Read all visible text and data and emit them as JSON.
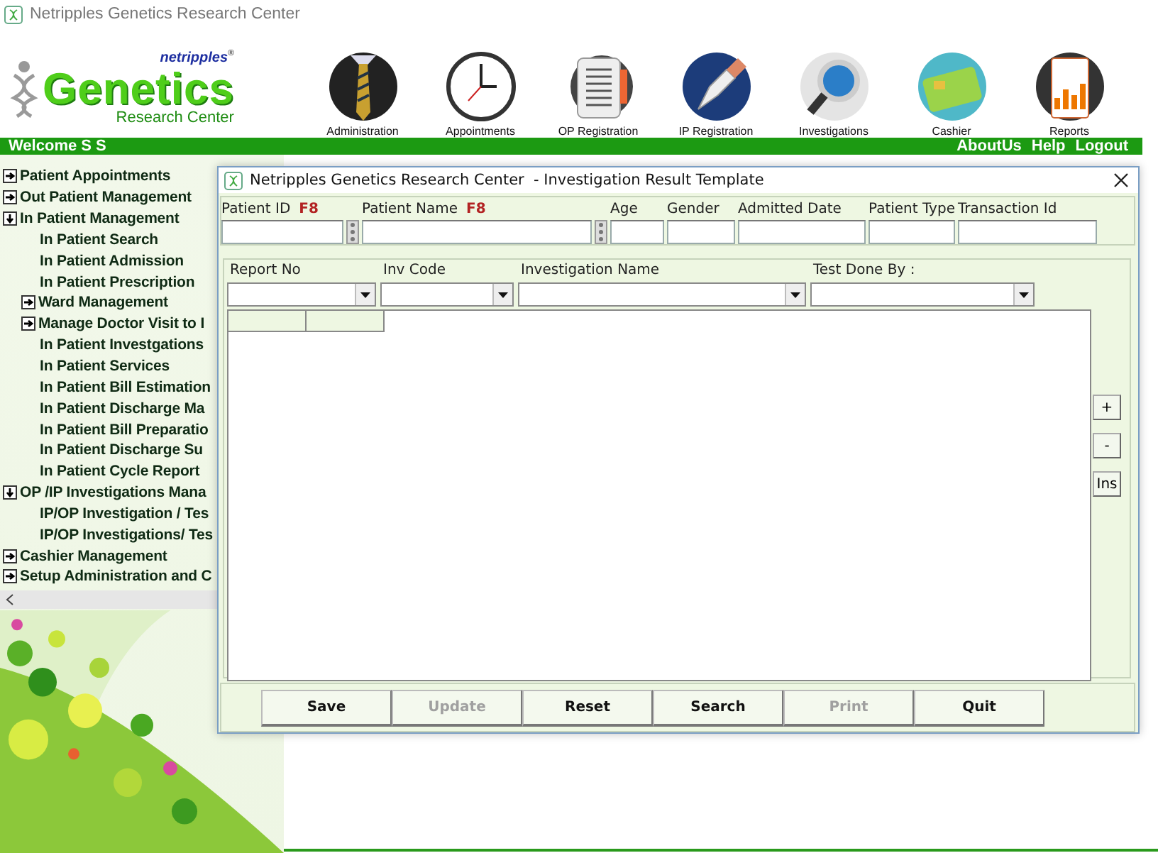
{
  "window": {
    "title": "Netripples Genetics Research Center"
  },
  "logo": {
    "brand": "netripples$^{®}$",
    "name": "Genetics",
    "tagline": "Research Center"
  },
  "modules": [
    {
      "label": "Administration",
      "kind": "suit"
    },
    {
      "label": "Appointments",
      "kind": "clock"
    },
    {
      "label": "OP Registration",
      "kind": "document"
    },
    {
      "label": "IP Registration",
      "kind": "pen"
    },
    {
      "label": "Investigations",
      "kind": "magnifier"
    },
    {
      "label": "Cashier",
      "kind": "card"
    },
    {
      "label": "Reports",
      "kind": "clipboard"
    }
  ],
  "nav_bar": {
    "welcome": "Welcome S S",
    "links": [
      "AboutUs",
      "Help",
      "Logout"
    ]
  },
  "sidebar": {
    "items": [
      {
        "label": "Patient Appointments",
        "kind": "folder",
        "expanded": false
      },
      {
        "label": "Out Patient Management",
        "kind": "folder",
        "expanded": false
      },
      {
        "label": "In Patient Management",
        "kind": "folder",
        "expanded": true,
        "children": [
          {
            "label": "In Patient Search",
            "kind": "leaf"
          },
          {
            "label": "In Patient Admission",
            "kind": "leaf"
          },
          {
            "label": "In Patient Prescription",
            "kind": "leaf"
          },
          {
            "label": "Ward Management",
            "kind": "folder",
            "expanded": false
          },
          {
            "label": "Manage Doctor Visit to I",
            "kind": "folder",
            "expanded": false
          },
          {
            "label": "In Patient Investgations",
            "kind": "leaf"
          },
          {
            "label": "In Patient Services",
            "kind": "leaf"
          },
          {
            "label": "In Patient Bill Estimation",
            "kind": "leaf"
          },
          {
            "label": "In Patient Discharge Ma",
            "kind": "leaf"
          },
          {
            "label": "In Patient Bill Preparatio",
            "kind": "leaf"
          },
          {
            "label": "In Patient Discharge Su",
            "kind": "leaf"
          },
          {
            "label": "In Patient Cycle Report",
            "kind": "leaf"
          }
        ]
      },
      {
        "label": "OP /IP Investigations Mana",
        "kind": "folder",
        "expanded": true,
        "children": [
          {
            "label": "IP/OP Investigation / Tes",
            "kind": "leaf"
          },
          {
            "label": "IP/OP Investigations/ Tes",
            "kind": "leaf"
          }
        ]
      },
      {
        "label": "Cashier Management",
        "kind": "folder",
        "expanded": false
      },
      {
        "label": "Setup Administration and C",
        "kind": "folder",
        "expanded": false
      }
    ]
  },
  "dialog": {
    "title": "Netripples Genetics Research Center  - Investigation Result Template",
    "patient_fields": [
      {
        "label": "Patient ID",
        "hint": "F8",
        "lookup": true
      },
      {
        "label": "Patient Name",
        "hint": "F8",
        "lookup": true
      },
      {
        "label": "Age",
        "lookup": false
      },
      {
        "label": "Gender",
        "lookup": false
      },
      {
        "label": "Admitted Date",
        "lookup": false
      },
      {
        "label": "Patient Type",
        "lookup": false
      },
      {
        "label": "Transaction Id",
        "lookup": false
      }
    ],
    "selectors": [
      {
        "label": "Report No"
      },
      {
        "label": "Inv Code"
      },
      {
        "label": "Investigation Name"
      },
      {
        "label": "Test Done By :"
      }
    ],
    "row_buttons": [
      "+",
      "-",
      "Ins"
    ],
    "actions": [
      {
        "label": "Save",
        "disabled": false
      },
      {
        "label": "Update",
        "disabled": true
      },
      {
        "label": "Reset",
        "disabled": false
      },
      {
        "label": "Search",
        "disabled": false
      },
      {
        "label": "Print",
        "disabled": true
      },
      {
        "label": "Quit",
        "disabled": false
      }
    ]
  }
}
